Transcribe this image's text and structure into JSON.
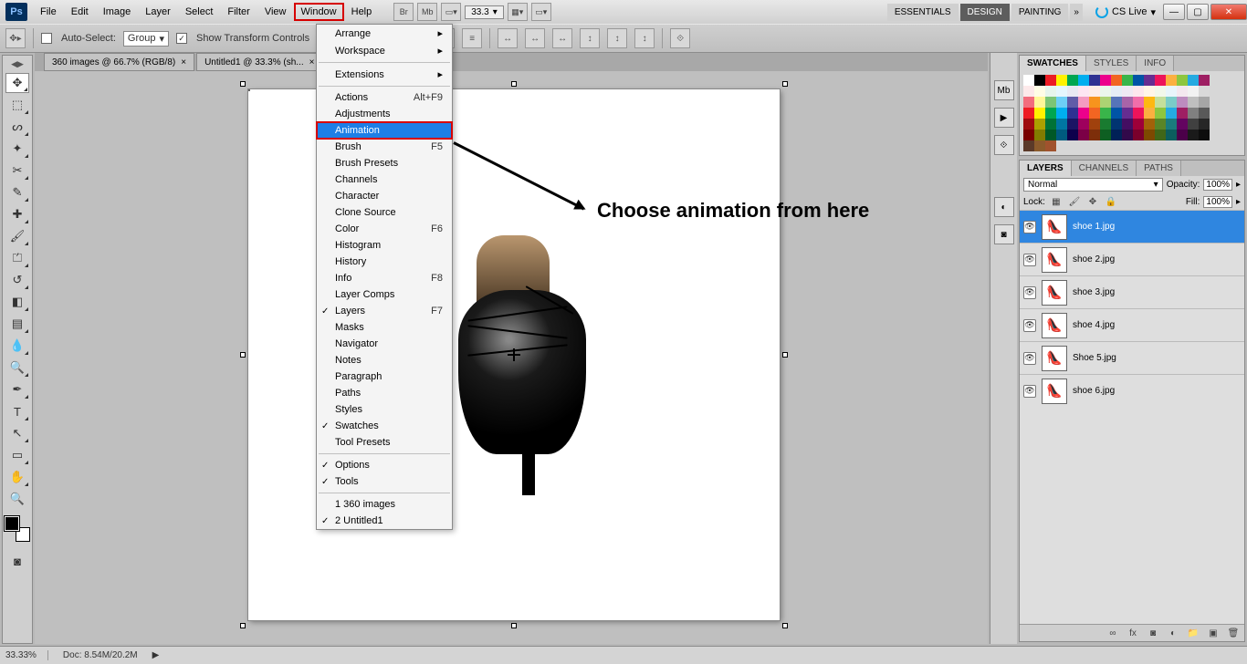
{
  "app": {
    "logo": "Ps"
  },
  "menubar": [
    "File",
    "Edit",
    "Image",
    "Layer",
    "Select",
    "Filter",
    "View",
    "Window",
    "Help"
  ],
  "highlight_menu": "Window",
  "topbar": {
    "zoom": "33.3",
    "workspaces": [
      "ESSENTIALS",
      "DESIGN",
      "PAINTING"
    ],
    "active_workspace": "DESIGN",
    "cslive": "CS Live"
  },
  "optionsbar": {
    "autoselect_label": "Auto-Select:",
    "autoselect_value": "Group",
    "show_transform": "Show Transform Controls"
  },
  "doc_tabs": [
    "360 images @ 66.7% (RGB/8)",
    "Untitled1 @ 33.3% (sh..."
  ],
  "menu": {
    "groups": [
      [
        {
          "label": "Arrange",
          "sub": true
        },
        {
          "label": "Workspace",
          "sub": true
        }
      ],
      [
        {
          "label": "Extensions",
          "sub": true
        }
      ],
      [
        {
          "label": "Actions",
          "sc": "Alt+F9"
        },
        {
          "label": "Adjustments"
        },
        {
          "label": "Animation",
          "hi": true
        },
        {
          "label": "Brush",
          "sc": "F5"
        },
        {
          "label": "Brush Presets"
        },
        {
          "label": "Channels"
        },
        {
          "label": "Character"
        },
        {
          "label": "Clone Source"
        },
        {
          "label": "Color",
          "sc": "F6"
        },
        {
          "label": "Histogram"
        },
        {
          "label": "History"
        },
        {
          "label": "Info",
          "sc": "F8"
        },
        {
          "label": "Layer Comps"
        },
        {
          "label": "Layers",
          "sc": "F7",
          "chk": true
        },
        {
          "label": "Masks"
        },
        {
          "label": "Navigator"
        },
        {
          "label": "Notes"
        },
        {
          "label": "Paragraph"
        },
        {
          "label": "Paths"
        },
        {
          "label": "Styles"
        },
        {
          "label": "Swatches",
          "chk": true
        },
        {
          "label": "Tool Presets"
        }
      ],
      [
        {
          "label": "Options",
          "chk": true
        },
        {
          "label": "Tools",
          "chk": true
        }
      ],
      [
        {
          "label": "1 360 images"
        },
        {
          "label": "2 Untitled1",
          "chk": true
        }
      ]
    ]
  },
  "annotation": "Choose animation from here",
  "swatches_panel": {
    "tabs": [
      "SWATCHES",
      "STYLES",
      "INFO"
    ],
    "active": "SWATCHES"
  },
  "layers_panel": {
    "tabs": [
      "LAYERS",
      "CHANNELS",
      "PATHS"
    ],
    "active": "LAYERS",
    "blend": "Normal",
    "opacity_label": "Opacity:",
    "opacity": "100%",
    "lock_label": "Lock:",
    "fill_label": "Fill:",
    "fill": "100%",
    "layers": [
      {
        "name": "shoe 1.jpg",
        "sel": true
      },
      {
        "name": "shoe 2.jpg"
      },
      {
        "name": "shoe 3.jpg"
      },
      {
        "name": "shoe 4.jpg"
      },
      {
        "name": "Shoe 5.jpg"
      },
      {
        "name": "shoe 6.jpg"
      }
    ]
  },
  "statusbar": {
    "zoom": "33.33%",
    "docsize": "Doc: 8.54M/20.2M"
  },
  "swatch_colors": [
    "#ffffff",
    "#000000",
    "#ec1c24",
    "#fff200",
    "#00a651",
    "#00aeef",
    "#2e3192",
    "#ec008c",
    "#f26522",
    "#39b54a",
    "#0054a6",
    "#662d91",
    "#ed145b",
    "#fbb040",
    "#8dc63f",
    "#25aae1",
    "#9e1f63",
    "#fde9ea",
    "#fffde5",
    "#e6f5ec",
    "#e5f6fd",
    "#e9e9f3",
    "#fde5f2",
    "#fdece7",
    "#ebf6eb",
    "#e5edf5",
    "#efe9f3",
    "#fde7ed",
    "#fff5e7",
    "#f2f8ea",
    "#e8f5fb",
    "#f4e8ef",
    "#f2f2f2",
    "#d9d9d9",
    "#f26d7d",
    "#fff799",
    "#7cc576",
    "#6dcff6",
    "#605ca8",
    "#f49ac1",
    "#f7941d",
    "#acd373",
    "#5674b9",
    "#a864a8",
    "#f06eaa",
    "#fdb813",
    "#c4df9b",
    "#7accc8",
    "#bd8cbf",
    "#bfbfbf",
    "#a6a6a6",
    "#ed1c24",
    "#fff200",
    "#00a651",
    "#00aeef",
    "#2e3192",
    "#ec008c",
    "#f26522",
    "#39b54a",
    "#0054a6",
    "#662d91",
    "#ed145b",
    "#fbb040",
    "#8dc63f",
    "#25aae1",
    "#9e1f63",
    "#808080",
    "#595959",
    "#9e0b0f",
    "#aba000",
    "#007236",
    "#0076a3",
    "#1b1464",
    "#9e005d",
    "#a0410d",
    "#197b30",
    "#003471",
    "#440e62",
    "#9e0039",
    "#a36209",
    "#598527",
    "#1a7b7d",
    "#630460",
    "#404040",
    "#262626",
    "#790000",
    "#827b00",
    "#005826",
    "#005b7f",
    "#0d004c",
    "#7b0046",
    "#7d2e0a",
    "#0e5f22",
    "#002157",
    "#32094a",
    "#7a002b",
    "#7d4900",
    "#406618",
    "#0c5d5e",
    "#4b0049",
    "#1a1a1a",
    "#0d0d0d",
    "#5b3a29",
    "#8b5a2b",
    "#a0522d"
  ]
}
